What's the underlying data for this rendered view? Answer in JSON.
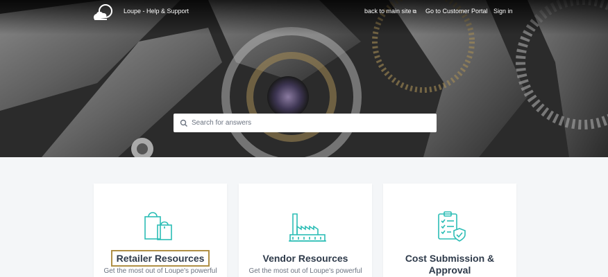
{
  "header": {
    "brand": "Loupe - Help & Support",
    "nav": [
      {
        "label": "back to main site"
      },
      {
        "label": "Go to Customer Portal"
      },
      {
        "label": "Sign in"
      }
    ]
  },
  "search": {
    "placeholder": "Search for answers"
  },
  "cards": [
    {
      "title": "Retailer Resources",
      "description": "Get the most out of Loupe's powerful",
      "icon": "shopping-bags-icon"
    },
    {
      "title": "Vendor Resources",
      "description": "Get the most out of Loupe's powerful",
      "icon": "factory-icon"
    },
    {
      "title": "Cost Submission & Approval",
      "description": "",
      "icon": "checklist-shield-icon"
    }
  ],
  "colors": {
    "accent": "#2bbdb5",
    "title_text": "#2e3a4a",
    "highlight_border": "#b08f44",
    "page_background": "#f4f6f8"
  }
}
